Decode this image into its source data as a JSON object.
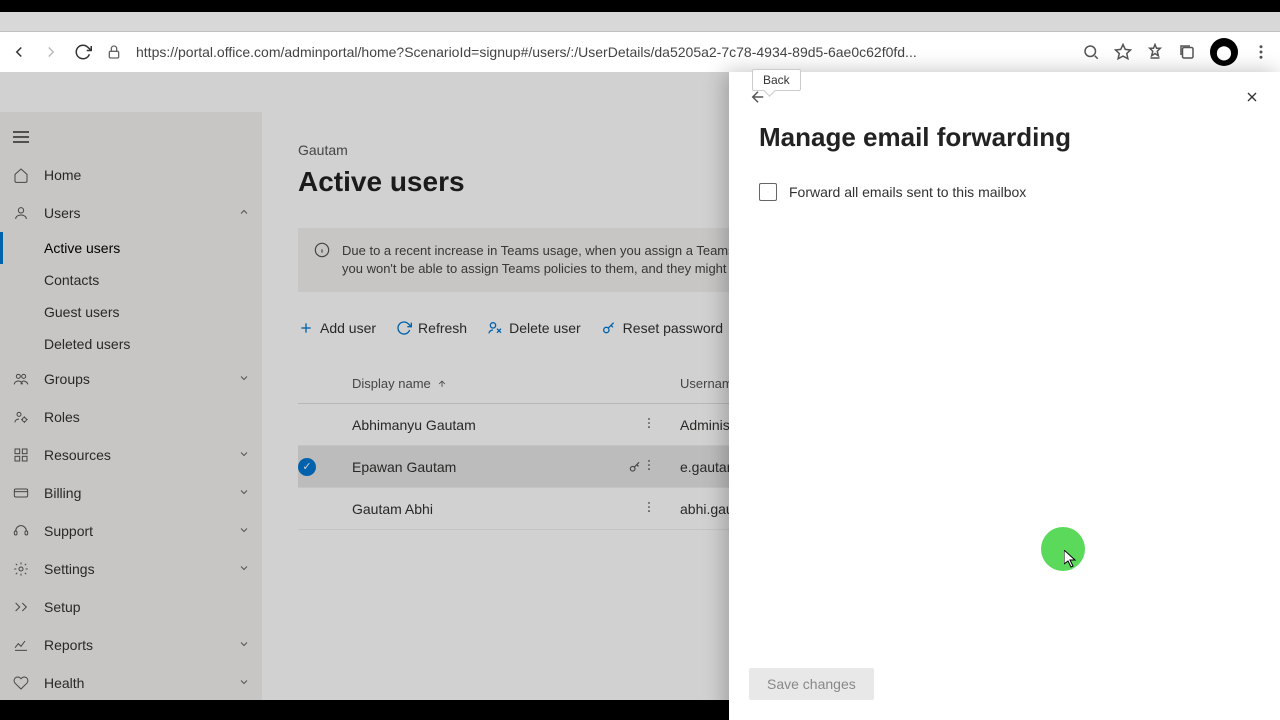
{
  "browser": {
    "url": "https://portal.office.com/adminportal/home?ScenarioId=signup#/users/:/UserDetails/da5205a2-7c78-4934-89d5-6ae0c62f0fd..."
  },
  "avatar_initial": "😊",
  "sidebar": {
    "items": [
      {
        "icon": "hamburger",
        "label": ""
      },
      {
        "icon": "home",
        "label": "Home"
      },
      {
        "icon": "user",
        "label": "Users",
        "expanded": true,
        "children": [
          {
            "label": "Active users",
            "active": true
          },
          {
            "label": "Contacts"
          },
          {
            "label": "Guest users"
          },
          {
            "label": "Deleted users"
          }
        ]
      },
      {
        "icon": "groups",
        "label": "Groups",
        "expandable": true
      },
      {
        "icon": "roles",
        "label": "Roles"
      },
      {
        "icon": "resources",
        "label": "Resources",
        "expandable": true
      },
      {
        "icon": "billing",
        "label": "Billing",
        "expandable": true
      },
      {
        "icon": "support",
        "label": "Support",
        "expandable": true
      },
      {
        "icon": "settings",
        "label": "Settings",
        "expandable": true
      },
      {
        "icon": "setup",
        "label": "Setup"
      },
      {
        "icon": "reports",
        "label": "Reports",
        "expandable": true
      },
      {
        "icon": "health",
        "label": "Health",
        "expandable": true
      }
    ]
  },
  "main": {
    "breadcrumb": "Gautam",
    "title": "Active users",
    "banner": "Due to a recent increase in Teams usage, when you assign a Teams license to a user it may take around 24 hours before they'll be fully set up. Until then, you won't be able to assign Teams policies to them, and they might not have access to some Teams features like calling and audio conferencing.",
    "commands": {
      "add": "Add user",
      "refresh": "Refresh",
      "delete": "Delete user",
      "reset": "Reset password",
      "more": "···"
    },
    "columns": {
      "name": "Display name",
      "username": "Username"
    },
    "rows": [
      {
        "name": "Abhimanyu Gautam",
        "username": "Administrator"
      },
      {
        "name": "Epawan Gautam",
        "username": "e.gautam@t",
        "selected": true,
        "key_icon": true
      },
      {
        "name": "Gautam Abhi",
        "username": "abhi.gautam"
      }
    ]
  },
  "panel": {
    "tooltip": "Back",
    "title": "Manage email forwarding",
    "checkbox_label": "Forward all emails sent to this mailbox",
    "save": "Save changes"
  }
}
